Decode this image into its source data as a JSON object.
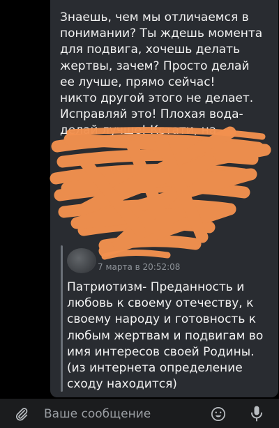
{
  "message": {
    "text": "Знаешь, чем мы отличаемся в\nпонимании? Ты ждешь момента\nдля подвига, хочешь делать\nжертвы, зачем? Просто делай\nее лучше, прямо сейчас!\nникто другой этого не делает.\nИсправляй это! Плохая вода-\nделай лучше! Кстати, на\n\n\n\n\n\n"
  },
  "quote": {
    "date": "7 марта в 20:52:08",
    "text": "Патриотизм- Преданность и\nлюбовь к своему отечеству, к\nсвоему народу и готовность к\nлюбым жертвам и подвигам во\nимя интересов своей Родины.\n(из интернета определение\nсходу находится)"
  },
  "input": {
    "placeholder": "Ваше сообщение"
  },
  "icons": {
    "attach": "paperclip-icon",
    "emoji": "emoji-icon",
    "mic": "microphone-icon"
  },
  "colors": {
    "background": "#000000",
    "bubble": "#292c31",
    "text": "#f2f2f2",
    "scribble": "#f2914e"
  }
}
